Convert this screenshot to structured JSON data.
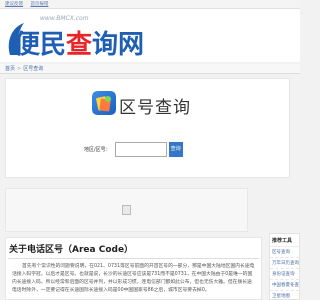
{
  "topbar": {
    "links": [
      "建议反馈",
      "首页报错"
    ]
  },
  "header": {
    "logo_text": "便民查询网",
    "logo_url": "www.BMCX.com"
  },
  "breadcrumb": {
    "home": "首页",
    "separator": ">",
    "current": "区号查询"
  },
  "tool": {
    "title": "区号查询",
    "field_label": "地区/区号：",
    "input_value": "",
    "button_label": "查询"
  },
  "sidebar": {
    "title": "推荐工具",
    "items": [
      "区号查询",
      "万年日历查询",
      "身份证查询",
      "中国春夏冬查询",
      "卫星地图"
    ]
  },
  "article": {
    "title": "关于电话区号（Area Code）",
    "body": "首先有个常识性的问题要说明，在021、0731等区号前面的开首区号的一部分，那是中国大陆地区国内长途电话接入码字冠，以后才是区号。也就是说，长沙的长途区号应该是731而不是0731，在中国大陆由于0是唯一的国内长途接入码，所以经常和后面的区号并列，并以形成习惯，连电信部门都如此公布，但也无伤大雅。但在拨长途电话时除外，一定要记得在长途国际长途接入码是00中国国家号86之后，城市区号要去掉0。"
  },
  "colors": {
    "accent": "#3477c8",
    "logo_blue": "#1e5fb4",
    "logo_red": "#e8262a"
  }
}
